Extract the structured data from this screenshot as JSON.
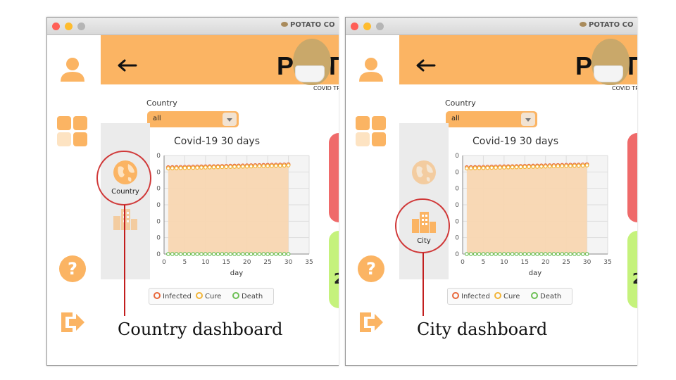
{
  "window": {
    "app_title": "POTATO CO"
  },
  "header": {
    "logo_text": "PO  T",
    "subtitle": "COVID TR"
  },
  "filter": {
    "label": "Country",
    "selected": "all"
  },
  "tabs": {
    "country_label": "Country",
    "city_label": "City"
  },
  "cards": {
    "green_value": "2"
  },
  "captions": {
    "left": "Country dashboard",
    "right": "City dashboard"
  },
  "colors": {
    "accent": "#fbb463",
    "infected": "#e8673a",
    "cure": "#f2b436",
    "death": "#6cbf54",
    "annotation": "#c21e1e"
  },
  "icons": [
    "user-icon",
    "apps-grid-icon",
    "help-icon",
    "logout-icon",
    "back-arrow-icon",
    "globe-icon",
    "city-buildings-icon"
  ],
  "chart_data": {
    "type": "line",
    "title": "Covid-19 30 days",
    "xlabel": "day",
    "ylabel": "",
    "xlim": [
      0,
      35
    ],
    "x_ticks": [
      "0",
      "5",
      "10",
      "15",
      "20",
      "25",
      "30",
      "35"
    ],
    "y_ticks": [
      "0",
      "0",
      "0",
      "0",
      "0",
      "0",
      "0"
    ],
    "grid": true,
    "legend_position": "bottom",
    "x": [
      1,
      2,
      3,
      4,
      5,
      6,
      7,
      8,
      9,
      10,
      11,
      12,
      13,
      14,
      15,
      16,
      17,
      18,
      19,
      20,
      21,
      22,
      23,
      24,
      25,
      26,
      27,
      28,
      29,
      30
    ],
    "series": [
      {
        "name": "Infected",
        "fill": true,
        "values": [
          0.88,
          0.881,
          0.882,
          0.883,
          0.884,
          0.885,
          0.886,
          0.887,
          0.888,
          0.889,
          0.89,
          0.891,
          0.892,
          0.893,
          0.894,
          0.895,
          0.896,
          0.897,
          0.898,
          0.899,
          0.9,
          0.901,
          0.902,
          0.903,
          0.904,
          0.905,
          0.906,
          0.907,
          0.908,
          0.91
        ]
      },
      {
        "name": "Cure",
        "fill": false,
        "values": [
          0.87,
          0.871,
          0.872,
          0.873,
          0.874,
          0.875,
          0.876,
          0.877,
          0.878,
          0.879,
          0.88,
          0.881,
          0.882,
          0.883,
          0.884,
          0.885,
          0.886,
          0.887,
          0.888,
          0.889,
          0.89,
          0.891,
          0.892,
          0.893,
          0.894,
          0.895,
          0.896,
          0.897,
          0.898,
          0.9
        ]
      },
      {
        "name": "Death",
        "fill": false,
        "values": [
          0,
          0,
          0,
          0,
          0,
          0,
          0,
          0,
          0,
          0,
          0,
          0,
          0,
          0,
          0,
          0,
          0,
          0,
          0,
          0,
          0,
          0,
          0,
          0,
          0,
          0,
          0,
          0,
          0,
          0
        ]
      }
    ]
  }
}
